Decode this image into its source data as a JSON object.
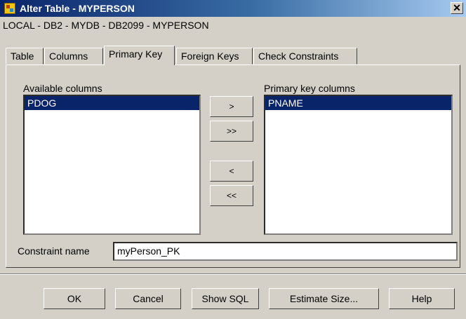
{
  "window": {
    "title": "Alter Table - MYPERSON",
    "close_label": "✕"
  },
  "path": "LOCAL - DB2 - MYDB - DB2099 - MYPERSON",
  "tabs": [
    {
      "label": "Table"
    },
    {
      "label": "Columns"
    },
    {
      "label": "Primary Key",
      "active": true
    },
    {
      "label": "Foreign Keys"
    },
    {
      "label": "Check Constraints"
    }
  ],
  "available": {
    "label": "Available columns",
    "items": [
      "PDOG"
    ]
  },
  "primary": {
    "label": "Primary key columns",
    "items": [
      "PNAME"
    ]
  },
  "move_buttons": {
    "add": ">",
    "add_all": ">>",
    "remove": "<",
    "remove_all": "<<"
  },
  "constraint": {
    "label": "Constraint name",
    "value": "myPerson_PK"
  },
  "footer": {
    "ok": "OK",
    "cancel": "Cancel",
    "show_sql": "Show SQL",
    "estimate": "Estimate Size...",
    "help": "Help"
  }
}
